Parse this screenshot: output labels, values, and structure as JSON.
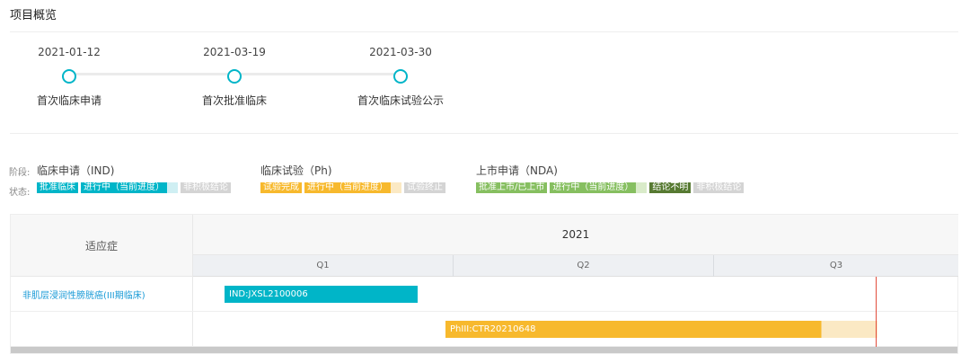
{
  "section_title": "项目概览",
  "milestones": [
    {
      "date": "2021-01-12",
      "label": "首次临床申请"
    },
    {
      "date": "2021-03-19",
      "label": "首次批准临床"
    },
    {
      "date": "2021-03-30",
      "label": "首次临床试验公示"
    }
  ],
  "legend": {
    "stage_prefix": "阶段:",
    "status_prefix": "状态:",
    "groups": [
      {
        "title": "临床申请（IND)",
        "chips": [
          "批准临床",
          "进行中（当前进度）",
          "非积极结论"
        ]
      },
      {
        "title": "临床试验（Ph)",
        "chips": [
          "试验完成",
          "进行中（当前进度）",
          "试验终止"
        ]
      },
      {
        "title": "上市申请（NDA)",
        "chips": [
          "批准上市/已上市",
          "进行中（当前进度）",
          "结论不明",
          "非积极结论"
        ]
      }
    ]
  },
  "gantt": {
    "indication_header": "适应症",
    "year": "2021",
    "quarters": [
      "Q1",
      "Q2",
      "Q3"
    ],
    "rows": [
      {
        "indication": "非肌层浸润性膀胱癌(III期临床)",
        "bar_label": "IND:JXSL2100006",
        "start": 0.12,
        "end": 0.86,
        "progress": 1.0,
        "color": "#00b5c8"
      },
      {
        "indication": "",
        "bar_label": "PhIII:CTR20210648",
        "start": 0.97,
        "end": 2.63,
        "progress": 0.87,
        "color": "#f7b92d"
      }
    ],
    "today": 2.62
  },
  "colors": {
    "ind": "#00b5c8",
    "ind_light": "#cfeff3",
    "ph": "#f7b92d",
    "ph_light": "#fbe9c4",
    "nda": "#86bf60",
    "nda_light": "#d9ebc9",
    "nda_dark": "#577a32",
    "negative": "#d4d4d4",
    "today": "#e24c3c"
  }
}
